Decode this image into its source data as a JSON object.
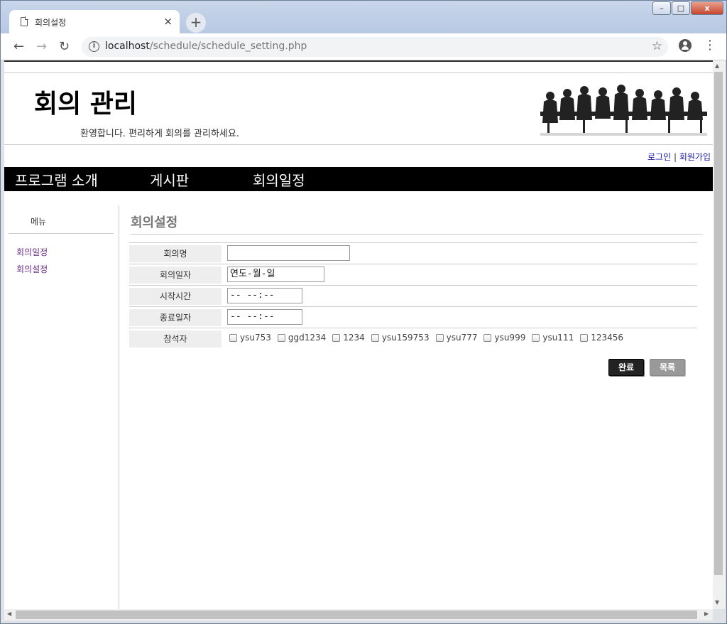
{
  "browser": {
    "tab_title": "회의설정",
    "tab_close": "×",
    "new_tab": "+",
    "url_host": "localhost",
    "url_path": "/schedule/schedule_setting.php",
    "window_buttons": {
      "minimize": "–",
      "maximize": "□",
      "close": "x"
    },
    "nav": {
      "back": "←",
      "forward": "→",
      "reload": "↻"
    }
  },
  "header": {
    "title": "회의 관리",
    "welcome": "환영합니다. 편리하게 회의를 관리하세요."
  },
  "auth": {
    "login": "로그인",
    "separator": "|",
    "signup": "회원가입"
  },
  "gnb": {
    "items": [
      "프로그램 소개",
      "게시판",
      "회의일정"
    ]
  },
  "sidebar": {
    "title": "메뉴",
    "links": [
      "회의일정",
      "회의설정"
    ]
  },
  "content": {
    "title": "회의설정",
    "rows": {
      "name_label": "회의명",
      "name_value": "",
      "date_label": "회의일자",
      "date_value": "연도-월-일",
      "start_label": "시작시간",
      "start_value": "-- --:--",
      "end_label": "종료일자",
      "end_value": "-- --:--",
      "attendee_label": "참석자"
    },
    "attendees": [
      "ysu753",
      "ggd1234",
      "1234",
      "ysu159753",
      "ysu777",
      "ysu999",
      "ysu111",
      "123456"
    ],
    "buttons": {
      "done": "완료",
      "list": "목록"
    }
  },
  "colors": {
    "nav_bg": "#000000",
    "link": "#1a1aa6",
    "sidebar_link": "#6a2d8c"
  }
}
